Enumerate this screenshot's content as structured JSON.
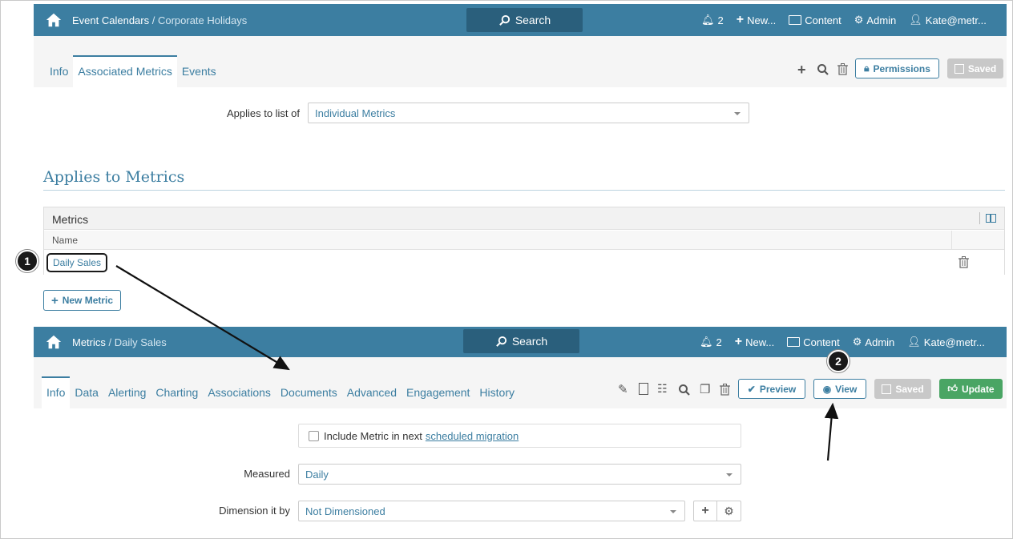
{
  "top": {
    "breadcrumb_main": "Event Calendars",
    "breadcrumb_sub": "Corporate Holidays",
    "search_label": "Search",
    "notifications_count": "2",
    "new_label": "New...",
    "content_label": "Content",
    "admin_label": "Admin",
    "user_label": "Kate@metr..."
  },
  "event_page": {
    "tabs": [
      "Info",
      "Associated Metrics",
      "Events"
    ],
    "permissions_label": "Permissions",
    "saved_label": "Saved",
    "applies_label": "Applies to list of",
    "applies_value": "Individual Metrics",
    "section_title": "Applies to Metrics",
    "table_title": "Metrics",
    "col_name": "Name",
    "row_link": "Daily Sales",
    "new_metric_label": "New Metric"
  },
  "metric_page": {
    "breadcrumb_main": "Metrics",
    "breadcrumb_sub": "Daily Sales",
    "search_label": "Search",
    "notifications_count": "2",
    "new_label": "New...",
    "content_label": "Content",
    "admin_label": "Admin",
    "user_label": "Kate@metr...",
    "tabs": [
      "Info",
      "Data",
      "Alerting",
      "Charting",
      "Associations",
      "Documents",
      "Advanced",
      "Engagement",
      "History"
    ],
    "preview_label": "Preview",
    "view_label": "View",
    "saved_label": "Saved",
    "update_label": "Update",
    "include_text": "Include Metric in next",
    "include_link": "scheduled migration",
    "measured_label": "Measured",
    "measured_value": "Daily",
    "dimension_label": "Dimension it by",
    "dimension_value": "Not Dimensioned"
  },
  "markers": [
    "1",
    "2"
  ],
  "colors": {
    "accent": "#3c7ea1",
    "green": "#4aa564",
    "topbar": "#3c7ea1"
  }
}
